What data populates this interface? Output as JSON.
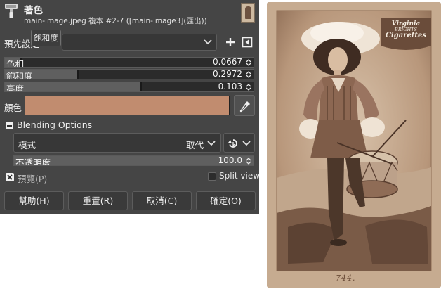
{
  "header": {
    "title": "著色",
    "subtitle": "main-image.jpeg 複本 #2-7 ([main-image3](匯出))"
  },
  "presets": {
    "label": "預先設定",
    "tooltip": "飽和度",
    "value": ""
  },
  "sliders": [
    {
      "label": "色相",
      "value": "0.0667",
      "fraction": 0.0667
    },
    {
      "label": "飽和度",
      "value": "0.2972",
      "fraction": 0.2972
    },
    {
      "label": "亮度",
      "value": "0.103",
      "fraction": 0.5515
    }
  ],
  "color": {
    "label": "顏色",
    "swatch": "#c18c6f"
  },
  "blending": {
    "title": "Blending Options",
    "mode_label": "模式",
    "mode_value": "取代",
    "opacity_label": "不透明度",
    "opacity_value": "100.0",
    "opacity_fraction": 1.0
  },
  "preview": {
    "label": "預覽(P)",
    "checked": true
  },
  "split_view": {
    "label": "Split view",
    "checked": false
  },
  "buttons": {
    "help": "幫助(H)",
    "reset": "重置(R)",
    "cancel": "取消(C)",
    "ok": "確定(O)"
  },
  "card": {
    "brand_line1": "Virginia",
    "brand_line2": "BRIGHTS",
    "brand_line3": "Cigarettes",
    "number": "744."
  },
  "icons": {
    "header": "colorize-icon",
    "add": "plus-icon",
    "menu": "preset-menu-icon",
    "picker": "eyedropper-icon",
    "composite": "composite-mode-icon"
  },
  "colors": {
    "panel_bg": "#454545",
    "slider_track": "#2b2b2b",
    "slider_fill": "#5f5f5f",
    "swatch": "#c18c6f",
    "sepia": "#b89a7e"
  }
}
